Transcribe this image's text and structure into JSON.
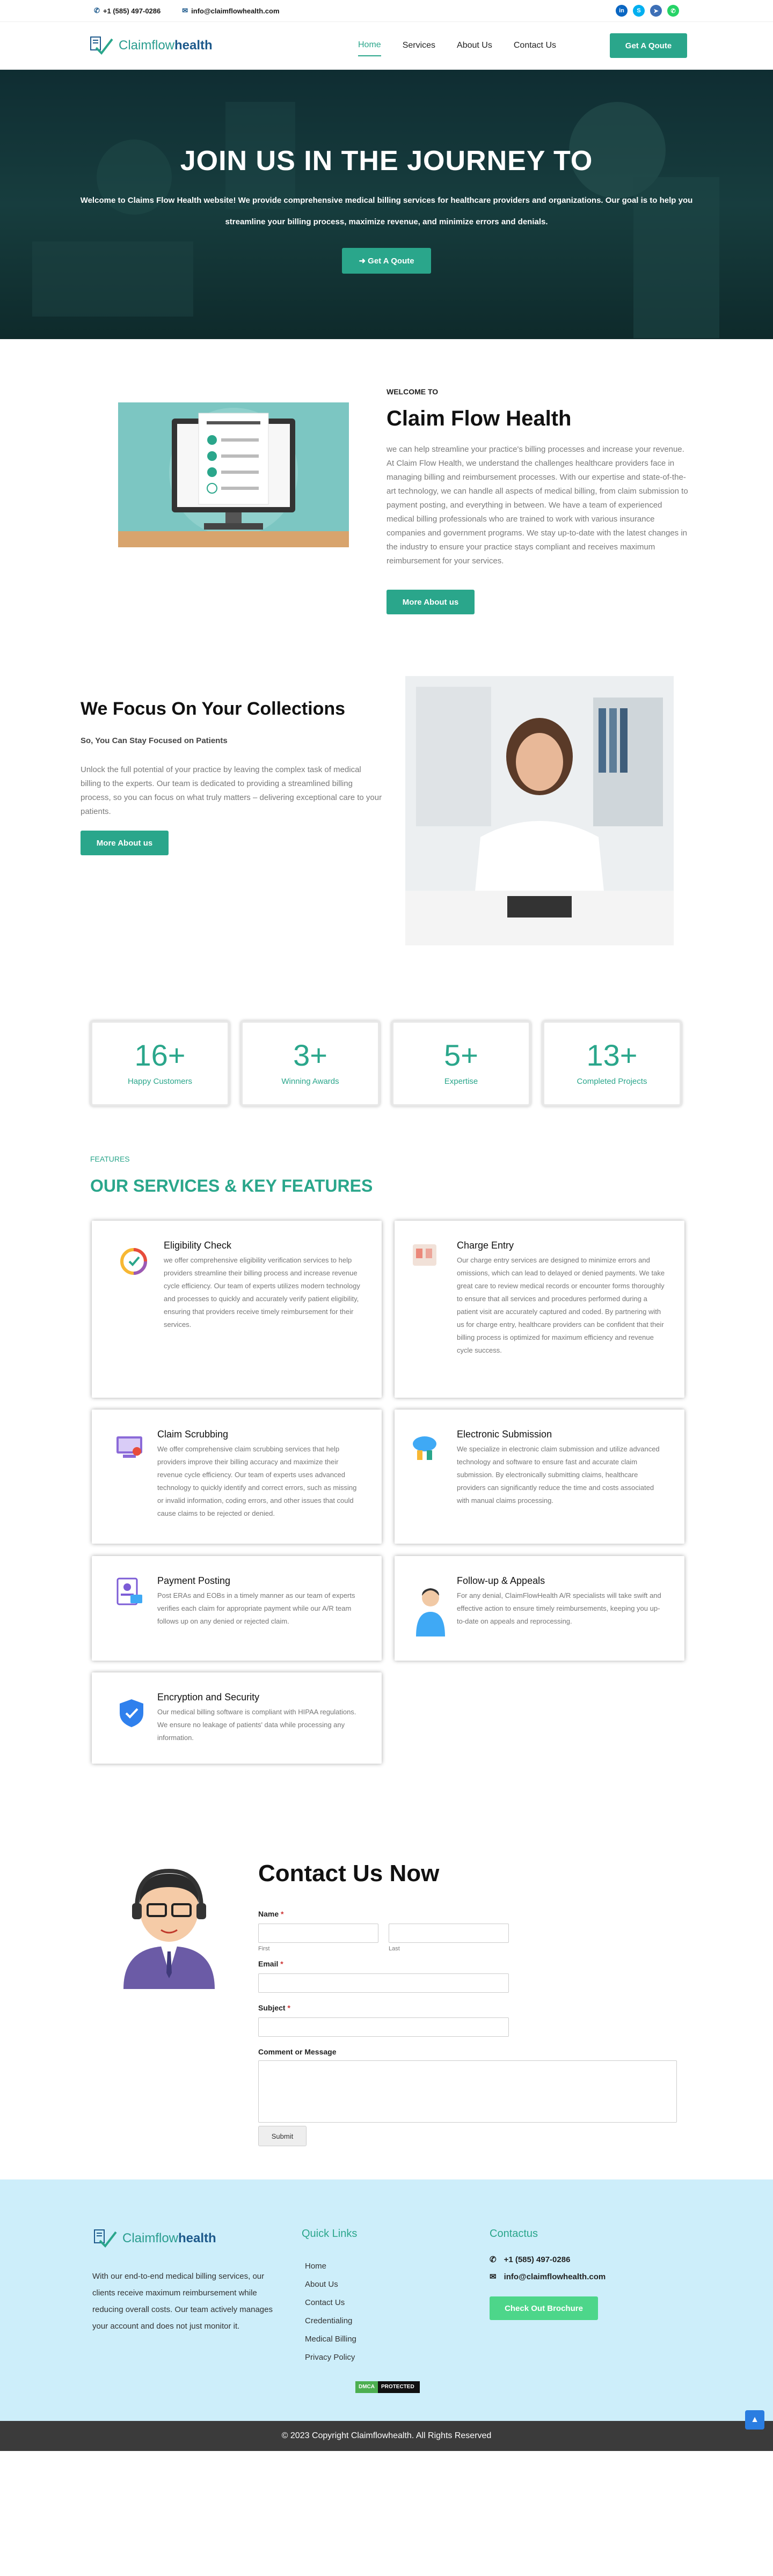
{
  "topbar": {
    "phone": "+1 (585) 497-0286",
    "email": "info@claimflowhealth.com",
    "social": [
      {
        "name": "linkedin-icon",
        "glyph": "in",
        "color": "#0a66c2"
      },
      {
        "name": "skype-icon",
        "glyph": "S",
        "color": "#00aff0"
      },
      {
        "name": "telegram-icon",
        "glyph": "➤",
        "color": "#3d6fb6"
      },
      {
        "name": "whatsapp-icon",
        "glyph": "✆",
        "color": "#25d366"
      }
    ]
  },
  "nav": {
    "logo_a": "Claimflow",
    "logo_b": "health",
    "items": [
      "Home",
      "Services",
      "About Us",
      "Contact Us"
    ],
    "cta": "Get A Qoute"
  },
  "hero": {
    "title": "JOIN US IN THE JOURNEY TO",
    "text": "Welcome to Claims Flow Health website! We provide comprehensive medical billing services for healthcare providers and organizations. Our goal is to help you streamline your billing process, maximize revenue, and minimize errors and denials.",
    "button": "➜ Get A Qoute"
  },
  "about": {
    "small": "WELCOME TO",
    "title": "Claim Flow Health",
    "text": "we can help streamline your practice's billing processes and increase your revenue. At Claim Flow Health, we understand the challenges healthcare providers face in managing billing and reimbursement processes. With our expertise and state-of-the-art technology, we can handle all aspects of medical billing, from claim submission to payment posting, and everything in between. We have a team of experienced medical billing professionals who are trained to work with various insurance companies and government programs. We stay up-to-date with the latest changes in the industry to ensure your practice stays compliant and receives maximum reimbursement for your services.",
    "button": "More About us"
  },
  "focus": {
    "title": "We Focus On Your Collections",
    "sub": "So, You Can Stay Focused on Patients",
    "text": "Unlock the full potential of your practice by leaving the complex task of medical billing to the experts. Our team is dedicated to providing a streamlined billing process, so you can focus on what truly matters – delivering exceptional care to your patients.",
    "button": "More About us"
  },
  "stats": [
    {
      "n": "16+",
      "l": "Happy Customers"
    },
    {
      "n": "3+",
      "l": "Winning Awards"
    },
    {
      "n": "5+",
      "l": "Expertise"
    },
    {
      "n": "13+",
      "l": "Completed Projects"
    }
  ],
  "services": {
    "tag": "FEATURES",
    "title": "OUR SERVICES & KEY FEATURES",
    "cards": [
      {
        "title": "Eligibility Check",
        "text": "we offer comprehensive eligibility verification services to help providers streamline their billing process and increase revenue cycle efficiency. Our team of experts utilizes modern technology and processes to quickly and accurately verify patient eligibility, ensuring that providers receive timely reimbursement for their services."
      },
      {
        "title": "Charge Entry",
        "text": "Our charge entry services are designed to minimize errors and omissions, which can lead to delayed or denied payments. We take great care to review medical records or encounter forms thoroughly to ensure that all services and procedures performed during a patient visit are accurately captured and coded. By partnering with us for charge entry, healthcare providers can be confident that their billing process is optimized for maximum efficiency and revenue cycle success."
      },
      {
        "title": "Claim Scrubbing",
        "text": "We offer comprehensive claim scrubbing services that help providers improve their billing accuracy and maximize their revenue cycle efficiency. Our team of experts uses advanced technology to quickly identify and correct errors, such as missing or invalid information, coding errors, and other issues that could cause claims to be rejected or denied."
      },
      {
        "title": "Electronic Submission",
        "text": "We specialize in electronic claim submission and utilize advanced technology and software to ensure fast and accurate claim submission. By electronically submitting claims, healthcare providers can significantly reduce the time and costs associated with manual claims processing."
      },
      {
        "title": "Payment Posting",
        "text": "Post ERAs and EOBs in a timely manner as our team of experts verifies each claim for appropriate payment while our A/R team follows up on any denied or rejected claim."
      },
      {
        "title": "Follow-up & Appeals",
        "text": "For any denial, ClaimFlowHealth A/R specialists will take swift and effective action to ensure timely reimbursements, keeping you up-to-date on appeals and reprocessing."
      },
      {
        "title": "Encryption and Security",
        "text": "Our medical billing software is compliant with HIPAA regulations. We ensure no leakage of patients' data while processing any information."
      }
    ]
  },
  "contact": {
    "title": "Contact Us Now",
    "name_label": "Name",
    "first": "First",
    "last": "Last",
    "email_label": "Email",
    "subject_label": "Subject",
    "comment_label": "Comment or Message",
    "required": "*",
    "submit": "Submit"
  },
  "footer": {
    "logo_a": "Claimflow",
    "logo_b": "health",
    "desc": "With our end-to-end medical billing services, our clients receive maximum reimbursement while reducing overall costs. Our team actively manages your account and does not just monitor it.",
    "links_title": "Quick Links",
    "links": [
      "Home",
      "About Us",
      "Contact Us",
      "Credentialing",
      "Medical Billing",
      "Privacy Policy"
    ],
    "contact_title": "Contactus",
    "phone": "+1 (585) 497-0286",
    "email": "info@claimflowhealth.com",
    "brochure": "Check Out Brochure",
    "badge_a": "DMCA",
    "badge_b": "PROTECTED",
    "copyright": "© 2023 Copyright Claimflowhealth. All Rights Reserved"
  }
}
